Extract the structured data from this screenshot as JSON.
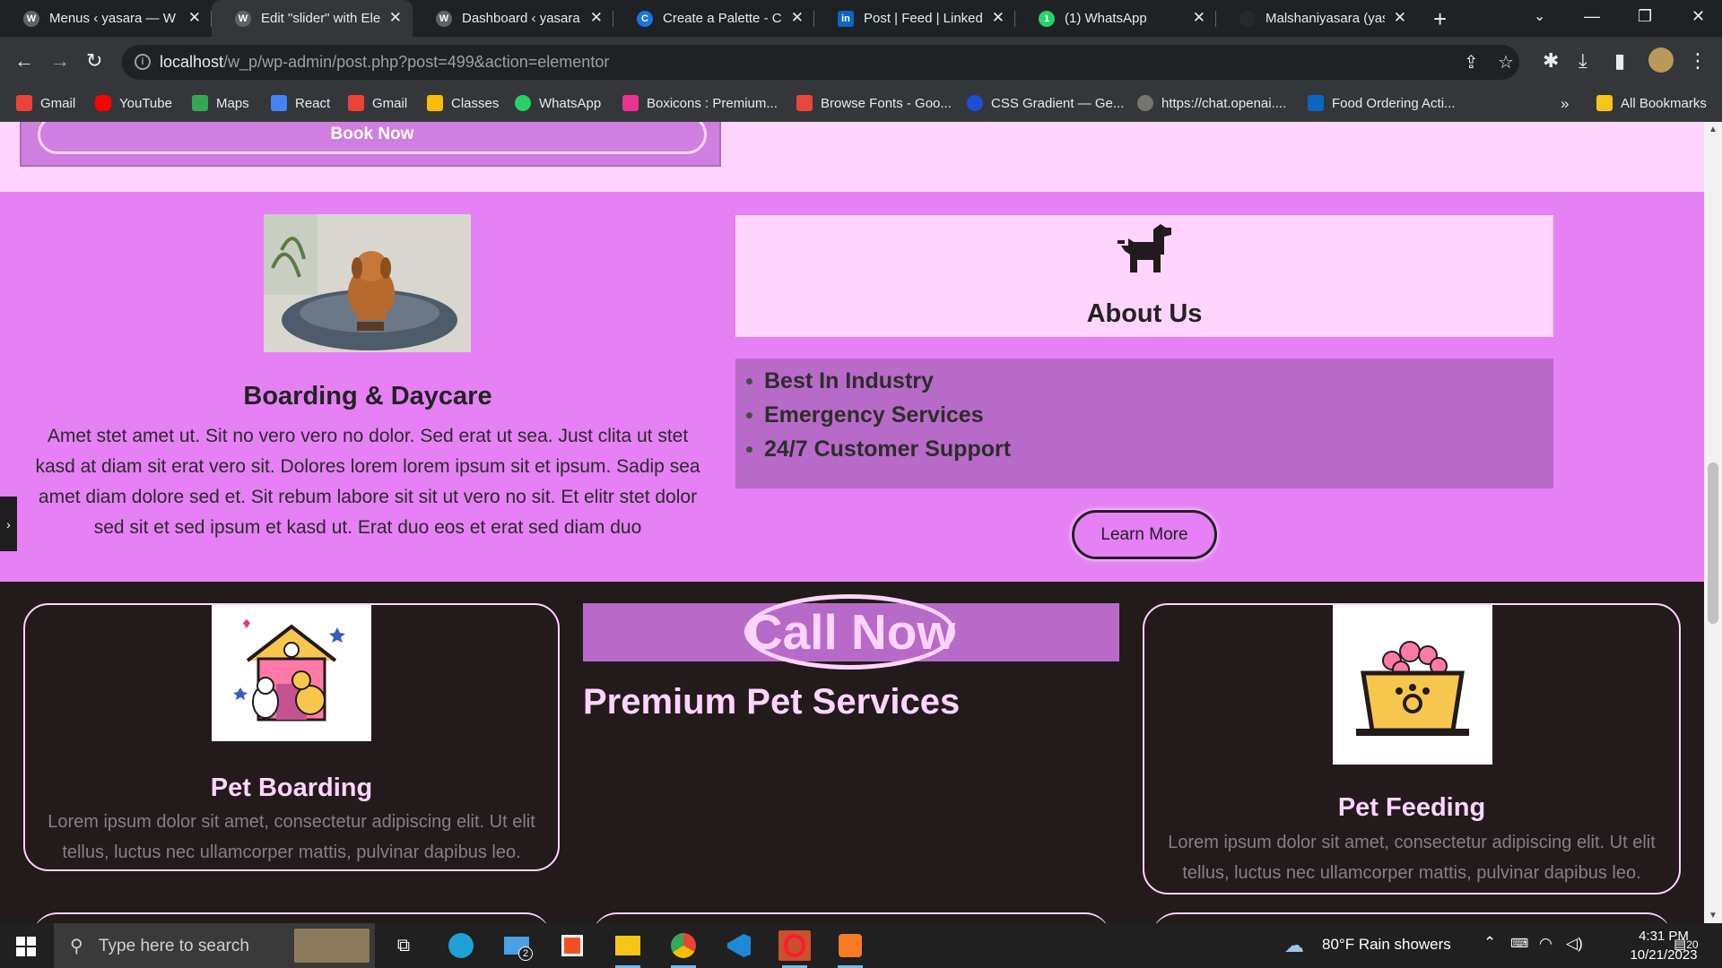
{
  "browser": {
    "tabs": [
      {
        "title": "Menus ‹ yasara — W",
        "active": false
      },
      {
        "title": "Edit \"slider\" with Elem",
        "active": true
      },
      {
        "title": "Dashboard ‹ yasara –",
        "active": false
      },
      {
        "title": "Create a Palette - Co",
        "active": false
      },
      {
        "title": "Post | Feed | LinkedIn",
        "active": false
      },
      {
        "title": "(1) WhatsApp",
        "active": false
      },
      {
        "title": "Malshaniyasara (yasa",
        "active": false
      }
    ],
    "url_host": "localhost",
    "url_path": "/w_p/wp-admin/post.php?post=499&action=elementor",
    "bookmarks": [
      {
        "label": "Gmail",
        "icon": "gmail-icon"
      },
      {
        "label": "YouTube",
        "icon": "youtube-icon"
      },
      {
        "label": "Maps",
        "icon": "maps-icon"
      },
      {
        "label": "React",
        "icon": "react-icon"
      },
      {
        "label": "Gmail",
        "icon": "gmail-icon"
      },
      {
        "label": "Classes",
        "icon": "classroom-icon"
      },
      {
        "label": "WhatsApp",
        "icon": "whatsapp-icon"
      },
      {
        "label": "Boxicons : Premium...",
        "icon": "boxicons-icon"
      },
      {
        "label": "Browse Fonts - Goo...",
        "icon": "google-fonts-icon"
      },
      {
        "label": "CSS Gradient — Ge...",
        "icon": "css-gradient-icon"
      },
      {
        "label": "https://chat.openai....",
        "icon": "openai-icon"
      },
      {
        "label": "Food Ordering Acti...",
        "icon": "linkedin-icon"
      }
    ],
    "bookmarks_overflow": "»",
    "all_bookmarks": "All Bookmarks"
  },
  "page": {
    "book_now": "Book Now",
    "boarding": {
      "title": "Boarding & Daycare",
      "text": "Amet stet amet ut. Sit no vero vero no dolor. Sed erat ut sea. Just clita ut stet kasd at diam sit erat vero sit. Dolores lorem lorem ipsum sit et ipsum. Sadip sea amet diam dolore sed et. Sit rebum labore sit sit ut vero no sit. Et elitr stet dolor sed sit et sed ipsum et kasd ut. Erat duo eos et erat sed diam duo"
    },
    "about": {
      "title": "About Us",
      "list": [
        "Best In Industry",
        "Emergency Services",
        "24/7 Customer Support"
      ],
      "button": "Learn More"
    },
    "services": {
      "call_now": "Call Now",
      "premium_title": "Premium Pet Services",
      "cards": [
        {
          "title": "Pet Boarding",
          "text": "Lorem ipsum dolor sit amet, consectetur adipiscing elit. Ut elit tellus, luctus nec ullamcorper mattis, pulvinar dapibus leo."
        },
        {
          "title": "Pet Feeding",
          "text": "Lorem ipsum dolor sit amet, consectetur adipiscing elit. Ut elit tellus, luctus nec ullamcorper mattis, pulvinar dapibus leo."
        }
      ]
    },
    "colors": {
      "light_pink": "#ffd4ff",
      "pink": "#e680f5",
      "purple": "#b86ac8",
      "dark": "#231a1c"
    }
  },
  "taskbar": {
    "search_placeholder": "Type here to search",
    "weather": "80°F  Rain showers",
    "time": "4:31 PM",
    "date": "10/21/2023",
    "notification_count": "20",
    "mail_badge": "2"
  }
}
